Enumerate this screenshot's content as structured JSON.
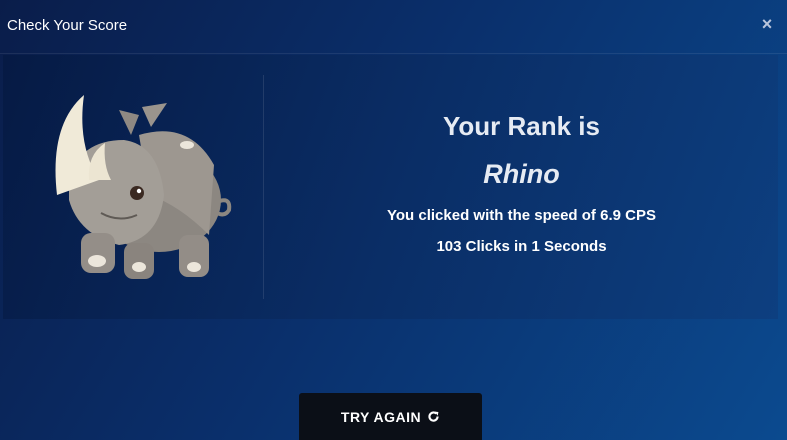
{
  "header": {
    "title": "Check Your Score",
    "close_icon": "close-icon",
    "close_glyph": "×"
  },
  "result": {
    "mascot_icon": "rhino-mascot-icon",
    "rank_heading": "Your Rank is",
    "rank_name": "Rhino",
    "speed_prefix": "You clicked with the speed of",
    "speed_value": "6.9 CPS",
    "clicks_count": "103",
    "clicks_label": "Clicks in",
    "duration": "1",
    "duration_unit": "Seconds"
  },
  "actions": {
    "try_again_label": "TRY AGAIN",
    "try_again_icon": "refresh-icon"
  },
  "colors": {
    "background": "#0a2f6b",
    "panel": "#0a2d65",
    "button": "#0b0f17",
    "text": "#ffffff"
  }
}
